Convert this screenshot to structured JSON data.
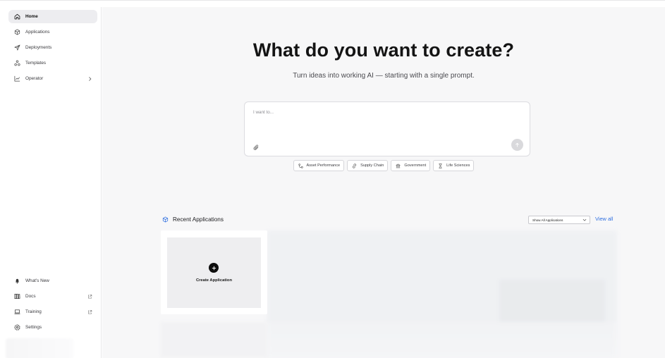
{
  "sidebar": {
    "items": [
      {
        "label": "Home",
        "icon": "home-icon",
        "active": true
      },
      {
        "label": "Applications",
        "icon": "cube-icon"
      },
      {
        "label": "Deployments",
        "icon": "send-icon"
      },
      {
        "label": "Templates",
        "icon": "templates-icon"
      },
      {
        "label": "Operator",
        "icon": "chart-line-icon",
        "trail_icon": "chevron-right-icon"
      }
    ],
    "bottom_items": [
      {
        "label": "What's New",
        "icon": "bell-icon"
      },
      {
        "label": "Docs",
        "icon": "book-icon",
        "trail_icon": "external-link-icon"
      },
      {
        "label": "Training",
        "icon": "laptop-icon",
        "trail_icon": "external-link-icon"
      },
      {
        "label": "Settings",
        "icon": "gear-icon"
      }
    ]
  },
  "hero": {
    "title": "What do you want to create?",
    "subtitle": "Turn ideas into working AI — starting with a single prompt."
  },
  "prompt": {
    "placeholder": "I want to...",
    "attach_icon": "paperclip-icon",
    "send_icon": "arrow-up-icon"
  },
  "chips": [
    {
      "label": "Asset Performance",
      "icon": "nodes-icon"
    },
    {
      "label": "Supply Chain",
      "icon": "link-icon"
    },
    {
      "label": "Government",
      "icon": "bank-icon"
    },
    {
      "label": "Life Sciences",
      "icon": "hourglass-icon"
    }
  ],
  "recent": {
    "title": "Recent Applications",
    "icon": "cube-icon",
    "filter_value": "Show All Applications",
    "view_all": "View all",
    "create_label": "Create Application"
  },
  "colors": {
    "accent_link": "#2f6fe0",
    "main_bg": "#f7f7f8",
    "active_nav_bg": "#ededf0"
  }
}
